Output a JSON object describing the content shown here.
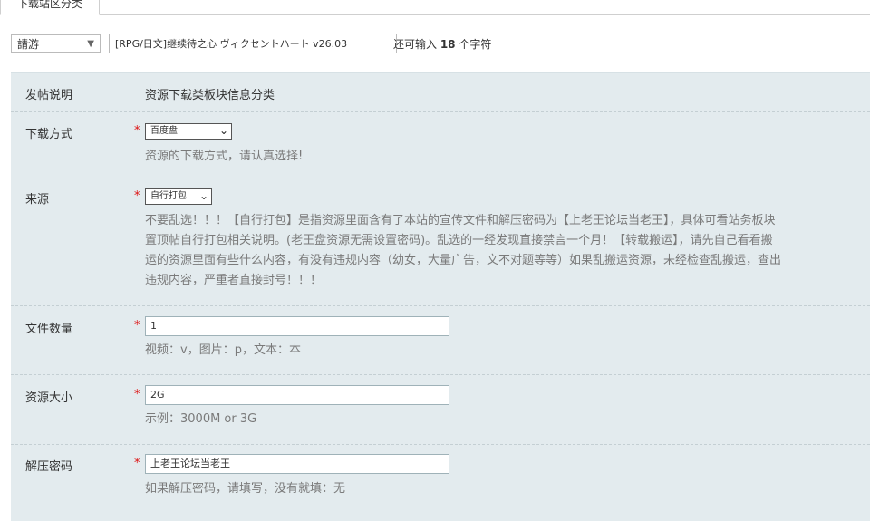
{
  "tabs": [
    {
      "label": "下载站区分类"
    }
  ],
  "top": {
    "type_select": "請游",
    "title_value": "[RPG/日文]继续待之心 ヴィクセントハート v26.03",
    "counter_prefix": "还可输入 ",
    "counter_number": "18",
    "counter_suffix": " 个字符"
  },
  "form": {
    "desc": {
      "label": "发帖说明",
      "value": "资源下载类板块信息分类"
    },
    "download": {
      "label": "下载方式",
      "select": "百度盘",
      "hint": "资源的下载方式，请认真选择!"
    },
    "source": {
      "label": "来源",
      "select": "自行打包",
      "hint_lines": [
        "不要乱选！！！【自行打包】是指资源里面含有了本站的宣传文件和解压密码为【上老王论坛当老王】，具体可看站务板块",
        "置顶帖自行打包相关说明。(老王盘资源无需设置密码)。乱选的一经发现直接禁言一个月！【转载搬运】，请先自己看看搬",
        "运的资源里面有些什么内容，有没有违规内容（幼女，大量广告，文不对题等等）如果乱搬运资源，未经检查乱搬运，查出",
        "违规内容，严重者直接封号！！！"
      ]
    },
    "file_count": {
      "label": "文件数量",
      "value": "1",
      "hint": "视频：v，图片：p，文本：本"
    },
    "size": {
      "label": "资源大小",
      "value": "2G",
      "hint": "示例：3000M or 3G"
    },
    "password": {
      "label": "解压密码",
      "value": "上老王论坛当老王",
      "hint": "如果解压密码，请填写，没有就填：无"
    }
  },
  "required_mark": "*"
}
